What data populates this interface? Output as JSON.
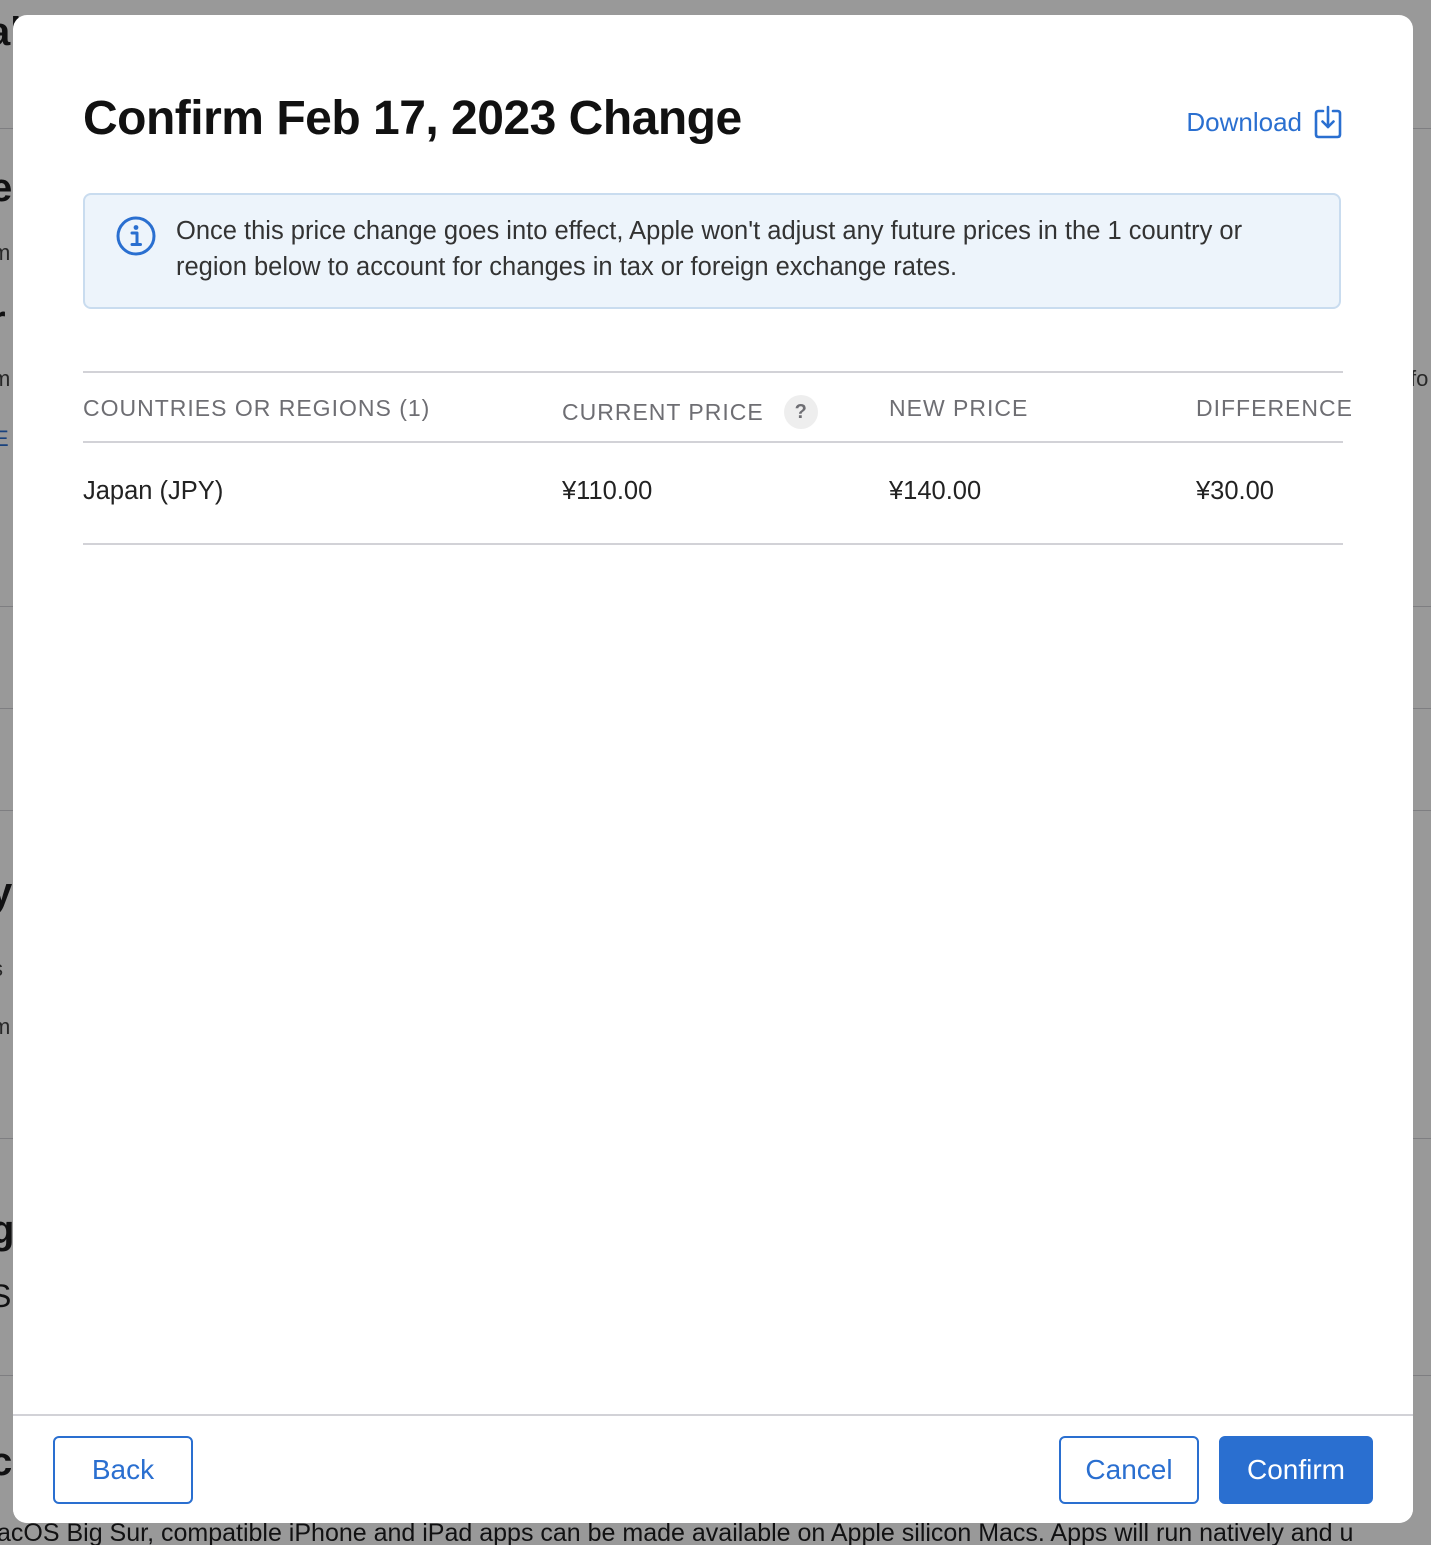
{
  "background": {
    "fragments": [
      "al",
      "e",
      "m",
      "r",
      "m",
      "E",
      "fo",
      "y",
      "s",
      "m",
      "g",
      "S",
      "c"
    ],
    "bottom_text": "acOS Big Sur, compatible iPhone and iPad apps can be made available on Apple silicon Macs. Apps will run natively and u"
  },
  "modal": {
    "title": "Confirm Feb 17, 2023 Change",
    "download_label": "Download",
    "info_message": "Once this price change goes into effect, Apple won't adjust any future prices in the 1 country or region below to account for changes in tax or foreign exchange rates.",
    "table": {
      "headers": {
        "country": "COUNTRIES OR REGIONS (1)",
        "current_price": "CURRENT PRICE",
        "current_price_help": "?",
        "new_price": "NEW PRICE",
        "difference": "DIFFERENCE"
      },
      "rows": [
        {
          "country": "Japan (JPY)",
          "current_price": "¥110.00",
          "new_price": "¥140.00",
          "difference": "¥30.00"
        }
      ]
    },
    "footer": {
      "back_label": "Back",
      "cancel_label": "Cancel",
      "confirm_label": "Confirm"
    }
  },
  "colors": {
    "accent": "#2a6fd0",
    "info_background": "#edf4fb",
    "info_border": "#c9dcef",
    "divider": "#d2d2d7",
    "muted_text": "#6e6e73"
  },
  "icons": {
    "download": "download-icon",
    "info": "info-icon",
    "help": "help-icon"
  }
}
